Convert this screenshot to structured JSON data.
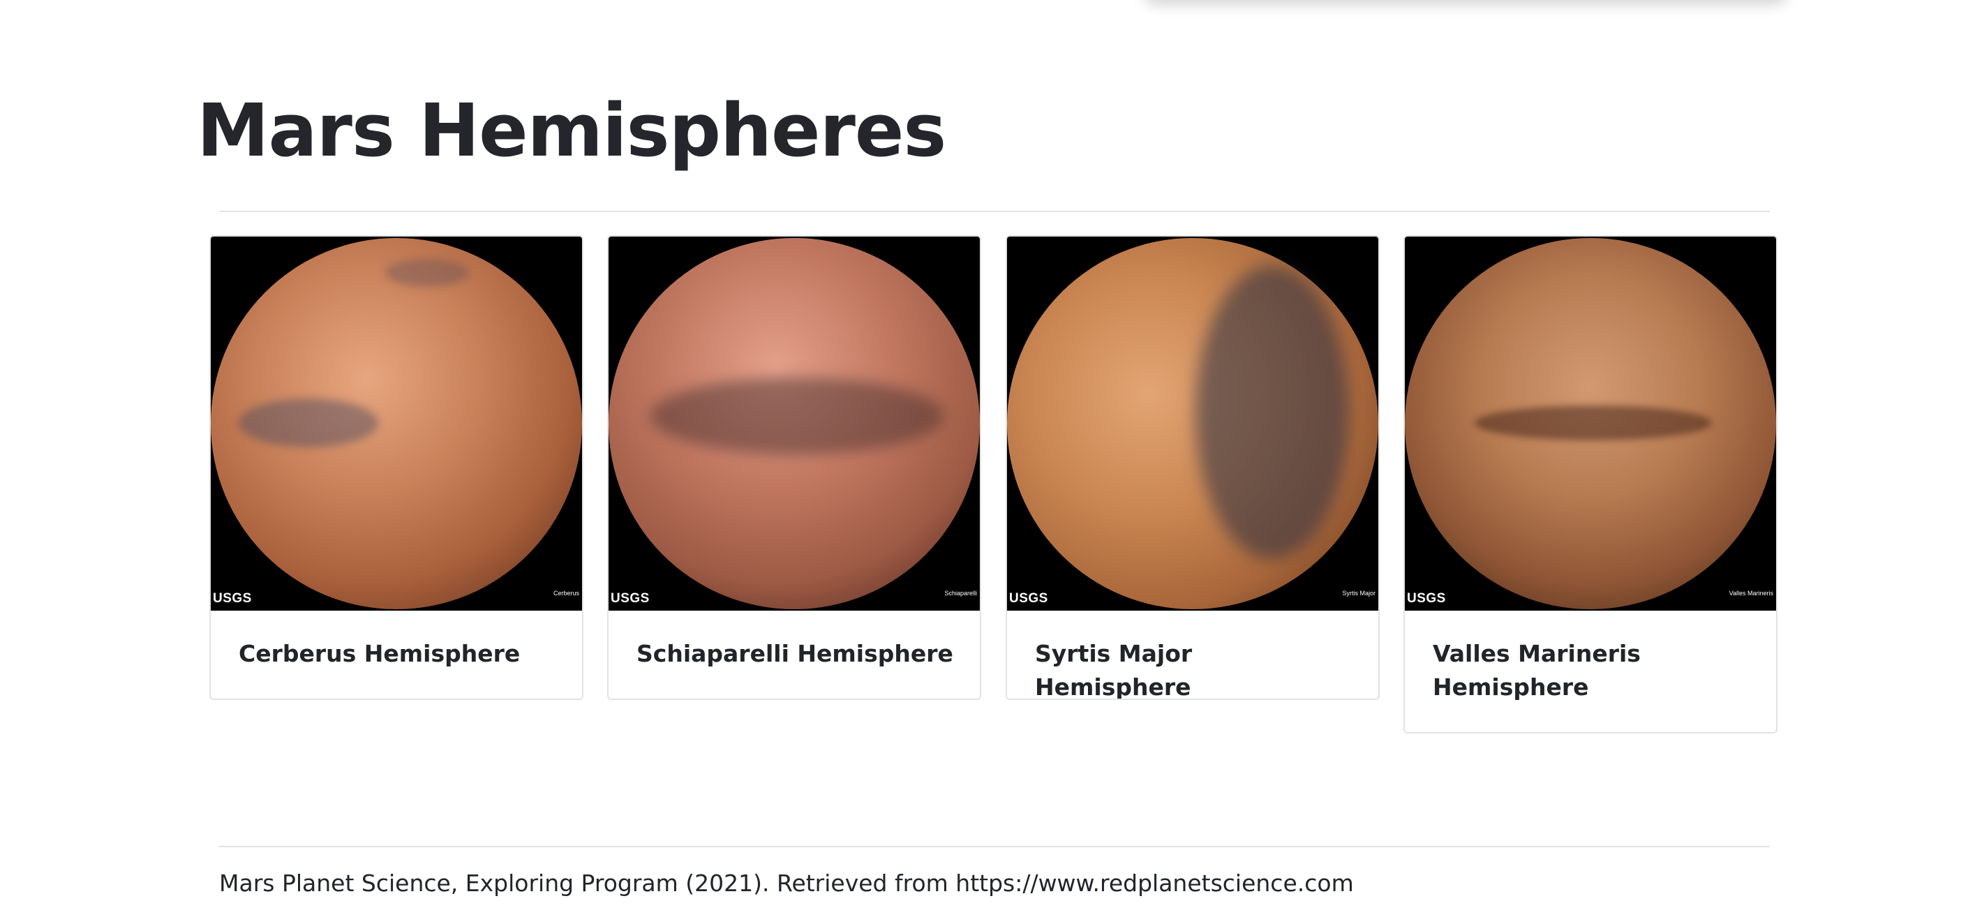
{
  "page": {
    "title": "Mars Hemispheres"
  },
  "hemispheres": [
    {
      "title": "Cerberus Hemisphere",
      "image_caption": "Cerberus",
      "logo": "USGS",
      "color": "#c57a4f"
    },
    {
      "title": "Schiaparelli Hemisphere",
      "image_caption": "Schiaparelli",
      "logo": "USGS",
      "color": "#b87258"
    },
    {
      "title": "Syrtis Major Hemisphere",
      "image_caption": "Syrtis Major",
      "logo": "USGS",
      "color": "#c27f4c"
    },
    {
      "title": "Valles Marineris Hemisphere",
      "image_caption": "Valles Marineris",
      "logo": "USGS",
      "color": "#a86a45"
    }
  ],
  "footer": {
    "text": "Mars Planet Science, Exploring Program (2021). Retrieved from https://www.redplanetscience.com"
  }
}
